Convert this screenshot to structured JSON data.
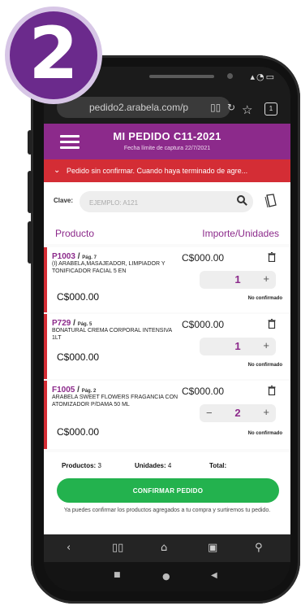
{
  "badge": {
    "number": "2"
  },
  "browser": {
    "url": "pedido2.arabela.com/p",
    "reader_icon": "book-icon",
    "refresh_icon": "refresh-icon",
    "tabs_count": "1"
  },
  "header": {
    "title": "MI PEDIDO C11-2021",
    "subtitle": "Fecha límite de captura 22/7/2021"
  },
  "alert": {
    "text": "Pedido sin confirmar. Cuando haya terminado de agre..."
  },
  "search": {
    "label": "Clave:",
    "placeholder": "EJEMPLO: A121"
  },
  "columns": {
    "product": "Producto",
    "amount": "Importe/Unidades"
  },
  "items": [
    {
      "code": "P1003",
      "page": "Pág. 7",
      "description": "(I) ARABELA,MASAJEADOR, LIMPIADOR Y TONIFICADOR FACIAL 5 EN",
      "price_left": "C$000.00",
      "price_right": "C$000.00",
      "qty": "1",
      "status": "No confirmado"
    },
    {
      "code": "P729",
      "page": "Pág. 5",
      "description": "BONATURAL CREMA CORPORAL INTENSIVA 1LT",
      "price_left": "C$000.00",
      "price_right": "C$000.00",
      "qty": "1",
      "status": "No confirmado"
    },
    {
      "code": "F1005",
      "page": "Pág. 2",
      "description": "ARABELA SWEET FLOWERS FRAGANCIA CON ATOMIZADOR P/DAMA 50 ML",
      "price_left": "C$000.00",
      "price_right": "C$000.00",
      "qty": "2",
      "status": "No confirmado"
    }
  ],
  "summary": {
    "products_label": "Productos:",
    "products_value": "3",
    "units_label": "Unidades:",
    "units_value": "4",
    "total_label": "Total:"
  },
  "confirm_button": "CONFIRMAR PEDIDO",
  "confirm_note": "Ya puedes confirmar los productos agregados a tu compra y surtiremos tu pedido.",
  "accent": "#8c2a8b",
  "alert_color": "#d42d35",
  "confirm_color": "#23b24e"
}
